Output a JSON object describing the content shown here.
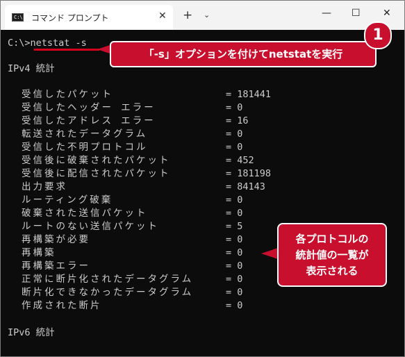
{
  "window": {
    "tab_title": "コマンド プロンプト",
    "tab_icon_text": "C:\\",
    "close_tab": "✕",
    "new_tab": "+",
    "dropdown": "⌄",
    "minimize": "—",
    "maximize": "☐",
    "close": "✕"
  },
  "terminal": {
    "prompt": "C:\\>",
    "command": "netstat -s",
    "ipv4_header": "IPv4 統計",
    "ipv6_header": "IPv6 統計",
    "stats": [
      {
        "label": "受信したパケット",
        "value": "= 181441"
      },
      {
        "label": "受信したヘッダー エラー",
        "value": "= 0"
      },
      {
        "label": "受信したアドレス エラー",
        "value": "= 16"
      },
      {
        "label": "転送されたデータグラム",
        "value": "= 0"
      },
      {
        "label": "受信した不明プロトコル",
        "value": "= 0"
      },
      {
        "label": "受信後に破棄されたパケット",
        "value": "= 452"
      },
      {
        "label": "受信後に配信されたパケット",
        "value": "= 181198"
      },
      {
        "label": "出力要求",
        "value": "= 84143"
      },
      {
        "label": "ルーティング破棄",
        "value": "= 0"
      },
      {
        "label": "破棄された送信パケット",
        "value": "= 0"
      },
      {
        "label": "ルートのない送信パケット",
        "value": "= 5"
      },
      {
        "label": "再構築が必要",
        "value": "= 0"
      },
      {
        "label": "再構築",
        "value": "= 0"
      },
      {
        "label": "再構築エラー",
        "value": "= 0"
      },
      {
        "label": "正常に断片化されたデータグラム",
        "value": "= 0"
      },
      {
        "label": "断片化できなかったデータグラム",
        "value": "= 0"
      },
      {
        "label": "作成された断片",
        "value": "= 0"
      }
    ]
  },
  "annotations": {
    "badge": "1",
    "callout1": "「-s」オプションを付けてnetstatを実行",
    "callout2_lines": [
      "各プロトコルの",
      "統計値の一覧が",
      "表示される"
    ]
  },
  "colors": {
    "accent": "#c8102e",
    "terminal_bg": "#0c0c0c",
    "terminal_fg": "#cccccc"
  }
}
